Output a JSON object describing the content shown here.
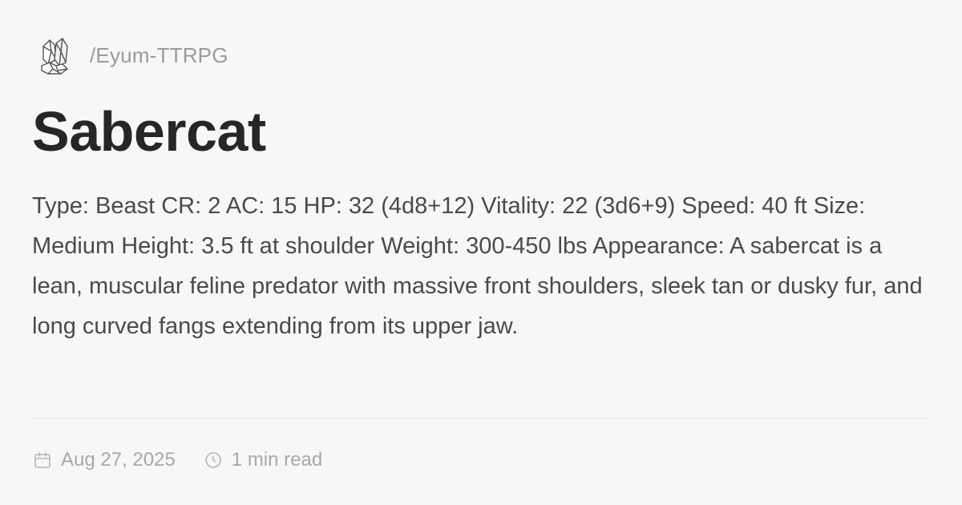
{
  "header": {
    "logo_icon": "crystal-cluster-icon",
    "site_name": "/Eyum-TTRPG"
  },
  "article": {
    "title": "Sabercat",
    "description": "Type: Beast CR: 2 AC: 15 HP: 32 (4d8+12) Vitality: 22 (3d6+9) Speed: 40 ft Size: Medium Height: 3.5 ft at shoulder Weight: 300-450 lbs Appearance: A sabercat is a lean, muscular feline predator with massive front shoulders, sleek tan or dusky fur, and long curved fangs extending from its upper jaw."
  },
  "meta": {
    "date_icon": "calendar-icon",
    "date": "Aug 27, 2025",
    "read_time_icon": "clock-icon",
    "read_time": "1 min read"
  },
  "colors": {
    "background": "#f8f7f8",
    "title": "#262626",
    "body_text": "#4a4a4a",
    "muted_text": "#a8a8a8"
  }
}
